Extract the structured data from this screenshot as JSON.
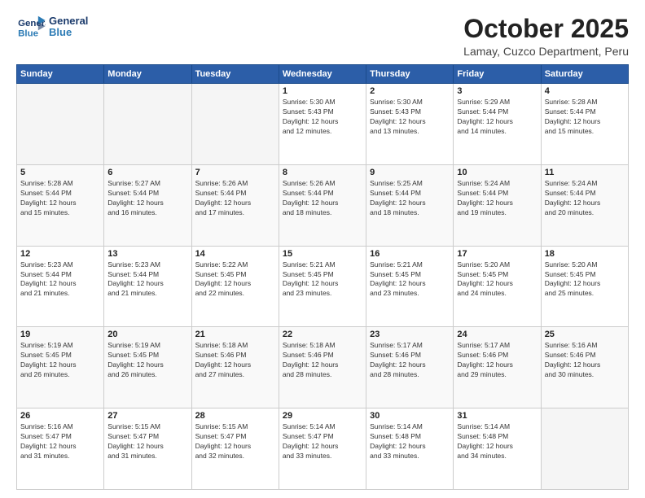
{
  "header": {
    "logo_line1": "General",
    "logo_line2": "Blue",
    "month": "October 2025",
    "location": "Lamay, Cuzco Department, Peru"
  },
  "weekdays": [
    "Sunday",
    "Monday",
    "Tuesday",
    "Wednesday",
    "Thursday",
    "Friday",
    "Saturday"
  ],
  "weeks": [
    [
      {
        "day": "",
        "info": ""
      },
      {
        "day": "",
        "info": ""
      },
      {
        "day": "",
        "info": ""
      },
      {
        "day": "1",
        "info": "Sunrise: 5:30 AM\nSunset: 5:43 PM\nDaylight: 12 hours\nand 12 minutes."
      },
      {
        "day": "2",
        "info": "Sunrise: 5:30 AM\nSunset: 5:43 PM\nDaylight: 12 hours\nand 13 minutes."
      },
      {
        "day": "3",
        "info": "Sunrise: 5:29 AM\nSunset: 5:44 PM\nDaylight: 12 hours\nand 14 minutes."
      },
      {
        "day": "4",
        "info": "Sunrise: 5:28 AM\nSunset: 5:44 PM\nDaylight: 12 hours\nand 15 minutes."
      }
    ],
    [
      {
        "day": "5",
        "info": "Sunrise: 5:28 AM\nSunset: 5:44 PM\nDaylight: 12 hours\nand 15 minutes."
      },
      {
        "day": "6",
        "info": "Sunrise: 5:27 AM\nSunset: 5:44 PM\nDaylight: 12 hours\nand 16 minutes."
      },
      {
        "day": "7",
        "info": "Sunrise: 5:26 AM\nSunset: 5:44 PM\nDaylight: 12 hours\nand 17 minutes."
      },
      {
        "day": "8",
        "info": "Sunrise: 5:26 AM\nSunset: 5:44 PM\nDaylight: 12 hours\nand 18 minutes."
      },
      {
        "day": "9",
        "info": "Sunrise: 5:25 AM\nSunset: 5:44 PM\nDaylight: 12 hours\nand 18 minutes."
      },
      {
        "day": "10",
        "info": "Sunrise: 5:24 AM\nSunset: 5:44 PM\nDaylight: 12 hours\nand 19 minutes."
      },
      {
        "day": "11",
        "info": "Sunrise: 5:24 AM\nSunset: 5:44 PM\nDaylight: 12 hours\nand 20 minutes."
      }
    ],
    [
      {
        "day": "12",
        "info": "Sunrise: 5:23 AM\nSunset: 5:44 PM\nDaylight: 12 hours\nand 21 minutes."
      },
      {
        "day": "13",
        "info": "Sunrise: 5:23 AM\nSunset: 5:44 PM\nDaylight: 12 hours\nand 21 minutes."
      },
      {
        "day": "14",
        "info": "Sunrise: 5:22 AM\nSunset: 5:45 PM\nDaylight: 12 hours\nand 22 minutes."
      },
      {
        "day": "15",
        "info": "Sunrise: 5:21 AM\nSunset: 5:45 PM\nDaylight: 12 hours\nand 23 minutes."
      },
      {
        "day": "16",
        "info": "Sunrise: 5:21 AM\nSunset: 5:45 PM\nDaylight: 12 hours\nand 23 minutes."
      },
      {
        "day": "17",
        "info": "Sunrise: 5:20 AM\nSunset: 5:45 PM\nDaylight: 12 hours\nand 24 minutes."
      },
      {
        "day": "18",
        "info": "Sunrise: 5:20 AM\nSunset: 5:45 PM\nDaylight: 12 hours\nand 25 minutes."
      }
    ],
    [
      {
        "day": "19",
        "info": "Sunrise: 5:19 AM\nSunset: 5:45 PM\nDaylight: 12 hours\nand 26 minutes."
      },
      {
        "day": "20",
        "info": "Sunrise: 5:19 AM\nSunset: 5:45 PM\nDaylight: 12 hours\nand 26 minutes."
      },
      {
        "day": "21",
        "info": "Sunrise: 5:18 AM\nSunset: 5:46 PM\nDaylight: 12 hours\nand 27 minutes."
      },
      {
        "day": "22",
        "info": "Sunrise: 5:18 AM\nSunset: 5:46 PM\nDaylight: 12 hours\nand 28 minutes."
      },
      {
        "day": "23",
        "info": "Sunrise: 5:17 AM\nSunset: 5:46 PM\nDaylight: 12 hours\nand 28 minutes."
      },
      {
        "day": "24",
        "info": "Sunrise: 5:17 AM\nSunset: 5:46 PM\nDaylight: 12 hours\nand 29 minutes."
      },
      {
        "day": "25",
        "info": "Sunrise: 5:16 AM\nSunset: 5:46 PM\nDaylight: 12 hours\nand 30 minutes."
      }
    ],
    [
      {
        "day": "26",
        "info": "Sunrise: 5:16 AM\nSunset: 5:47 PM\nDaylight: 12 hours\nand 31 minutes."
      },
      {
        "day": "27",
        "info": "Sunrise: 5:15 AM\nSunset: 5:47 PM\nDaylight: 12 hours\nand 31 minutes."
      },
      {
        "day": "28",
        "info": "Sunrise: 5:15 AM\nSunset: 5:47 PM\nDaylight: 12 hours\nand 32 minutes."
      },
      {
        "day": "29",
        "info": "Sunrise: 5:14 AM\nSunset: 5:47 PM\nDaylight: 12 hours\nand 33 minutes."
      },
      {
        "day": "30",
        "info": "Sunrise: 5:14 AM\nSunset: 5:48 PM\nDaylight: 12 hours\nand 33 minutes."
      },
      {
        "day": "31",
        "info": "Sunrise: 5:14 AM\nSunset: 5:48 PM\nDaylight: 12 hours\nand 34 minutes."
      },
      {
        "day": "",
        "info": ""
      }
    ]
  ]
}
